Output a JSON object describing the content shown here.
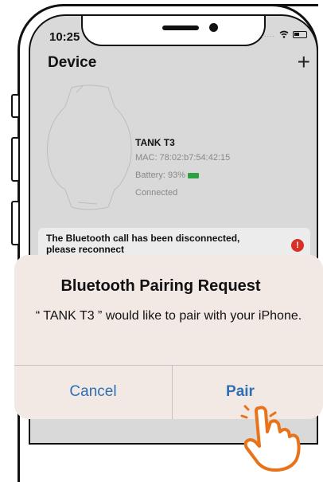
{
  "status_bar": {
    "time": "10:25",
    "signal": "....."
  },
  "header": {
    "title": "Device",
    "add_label": "+"
  },
  "device": {
    "name": "TANK T3",
    "mac": "MAC: 78:02:b7:54:42:15",
    "battery_label": "Battery: 93%",
    "battery_percent": 93,
    "status": "Connected"
  },
  "banner": {
    "text": "The Bluetooth call has been disconnected, please reconnect",
    "alert_glyph": "!"
  },
  "dialog": {
    "title": "Bluetooth Pairing Request",
    "message": "“ TANK T3 ” would like to pair with your iPhone.",
    "cancel_label": "Cancel",
    "pair_label": "Pair"
  },
  "colors": {
    "accent": "#2f6fb4",
    "alert": "#d93025",
    "battery": "#2ea043",
    "hand": "#e8731a"
  },
  "icons": {
    "add": "plus-icon",
    "alert": "alert-icon",
    "pointer": "hand-pointer-icon"
  }
}
